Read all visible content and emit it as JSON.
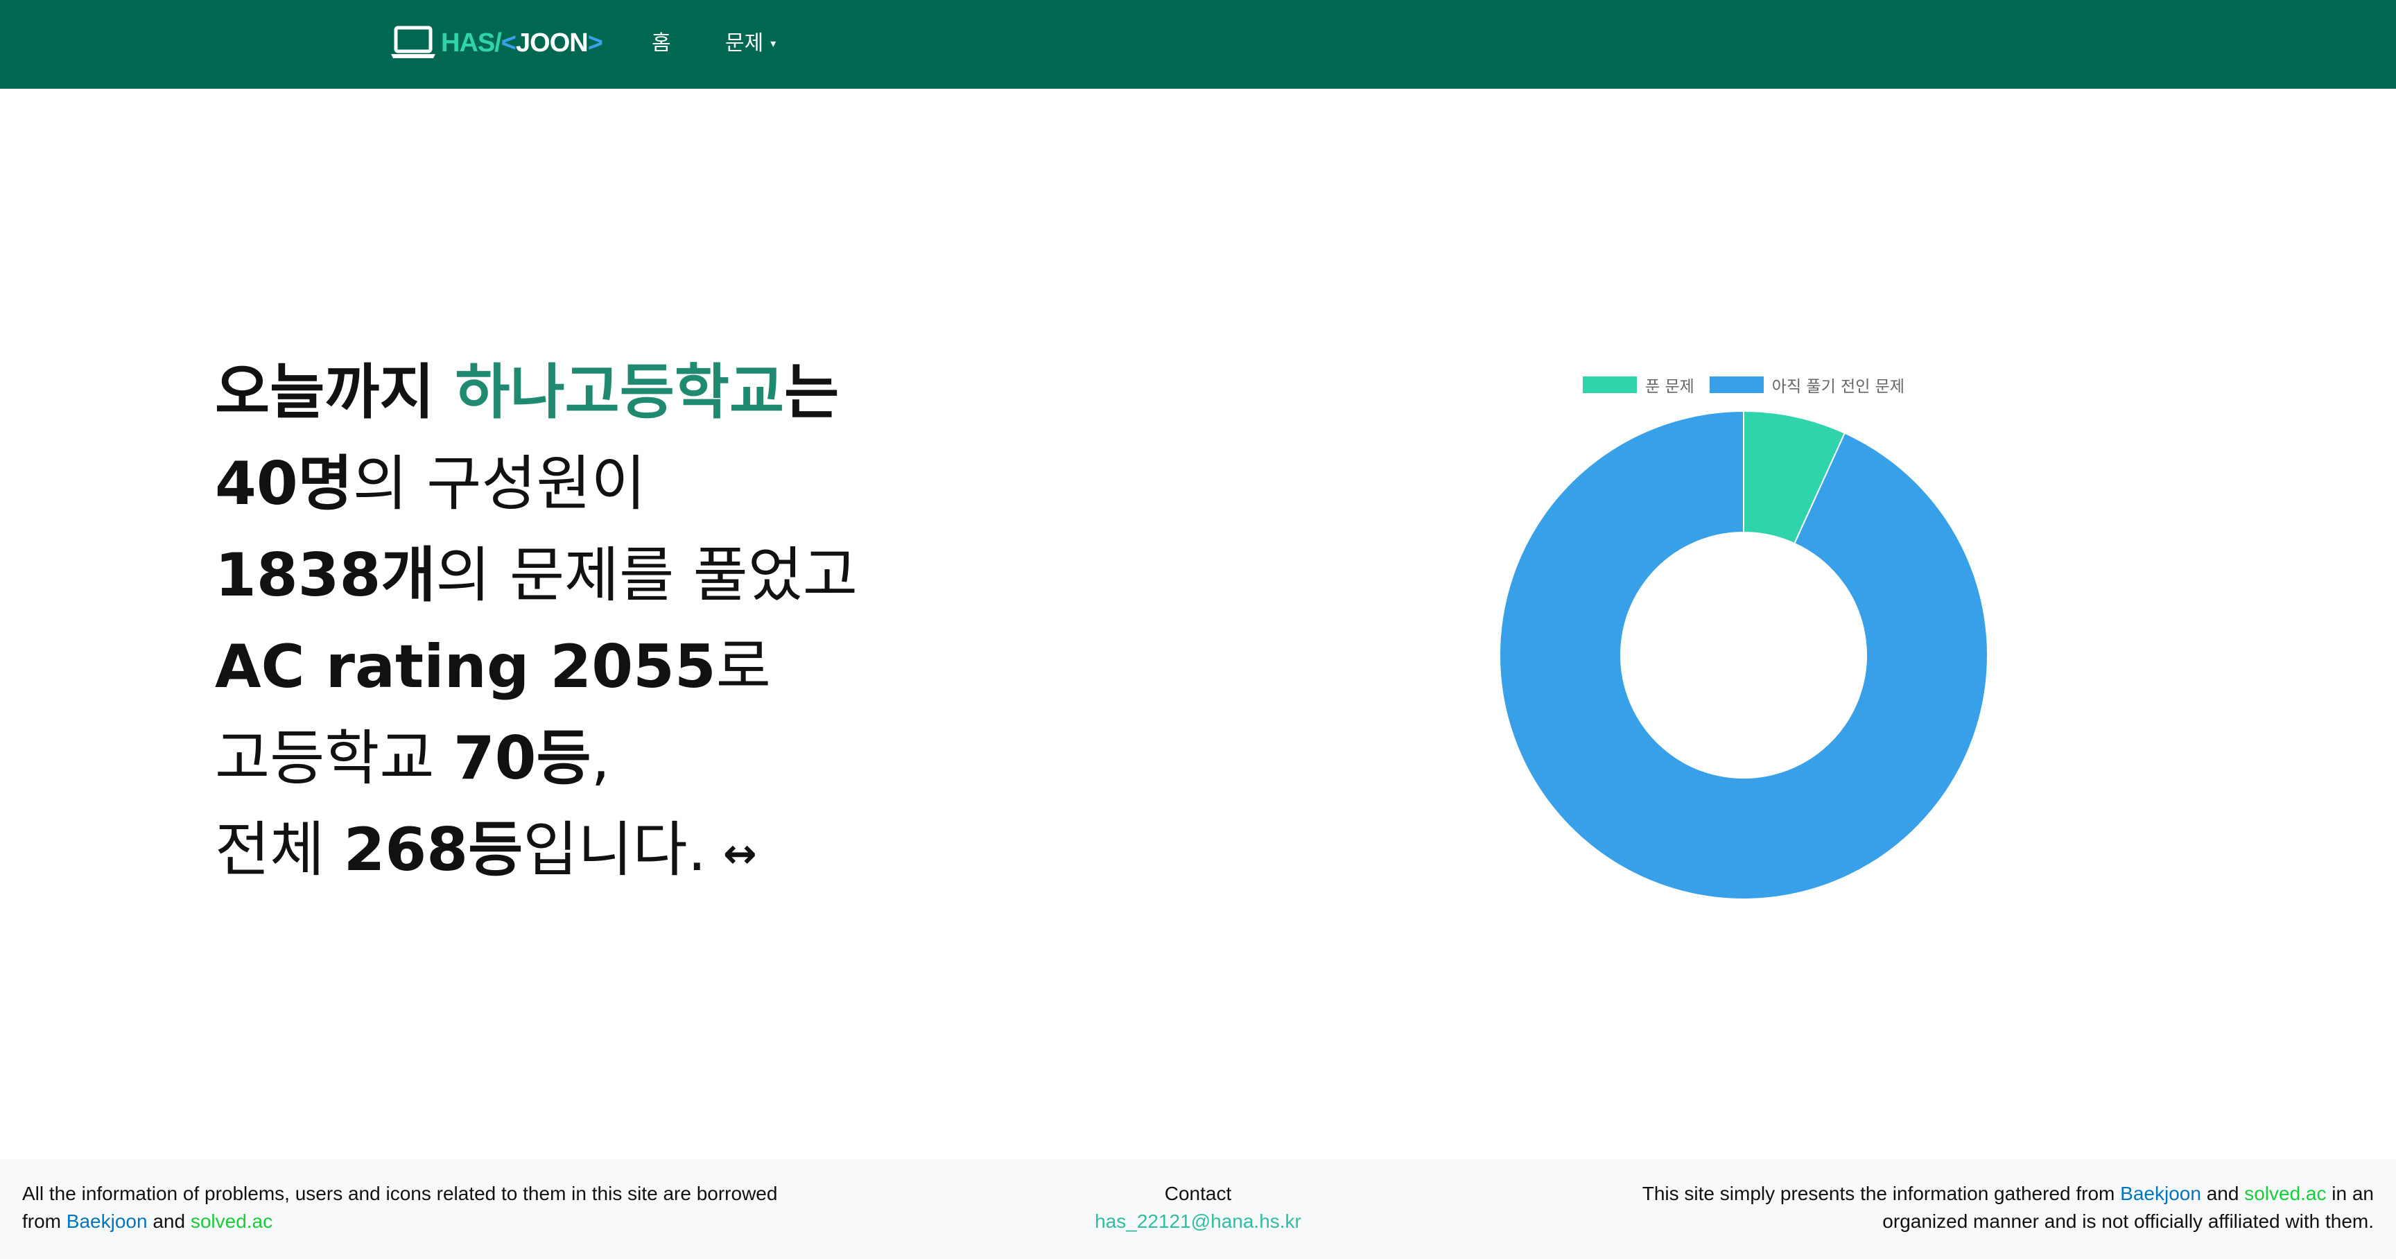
{
  "navbar": {
    "brand": {
      "has": "HAS",
      "slash": "/",
      "open": "<",
      "joon": "JOON",
      "close": ">"
    },
    "home_label": "홈",
    "problems_label": "문제",
    "problems_caret": "▾",
    "background_color": "#006850"
  },
  "hero": {
    "line1_prefix": "오늘까지 ",
    "school_name": "하나고등학교",
    "line1_suffix": "는",
    "member_count": "40명",
    "line2_suffix": "의 구성원이",
    "solved_count": "1838개",
    "line3_suffix": "의 문제를 풀었고",
    "rating": "AC rating 2055",
    "line4_suffix": "로",
    "line5_prefix": "고등학교 ",
    "school_rank": "70등",
    "line5_suffix": ",",
    "line6_prefix": "전체 ",
    "overall_rank": "268등",
    "line6_suffix": "입니다.",
    "swap_icon": "↔",
    "accent_color": "#1f8a6f"
  },
  "chart_data": {
    "type": "pie",
    "categories": [
      "푼 문제",
      "아직 풀기 전인 문제"
    ],
    "values": [
      6.8,
      93.2
    ],
    "colors": [
      "#2fd4aa",
      "#38a0e8"
    ],
    "legend": "top"
  },
  "footer": {
    "left_text": "All the information of problems, users and icons related to them in this site are borrowed",
    "left_from": "from ",
    "baekjoon": "Baekjoon",
    "and": " and ",
    "solved_ac": "solved.ac",
    "contact_label": "Contact",
    "contact_email": "has_22121@hana.hs.kr",
    "right_prefix": "This site simply presents the information gathered from ",
    "right_mid": " in an",
    "right_line2": "organized manner and is not officially affiliated with them."
  }
}
